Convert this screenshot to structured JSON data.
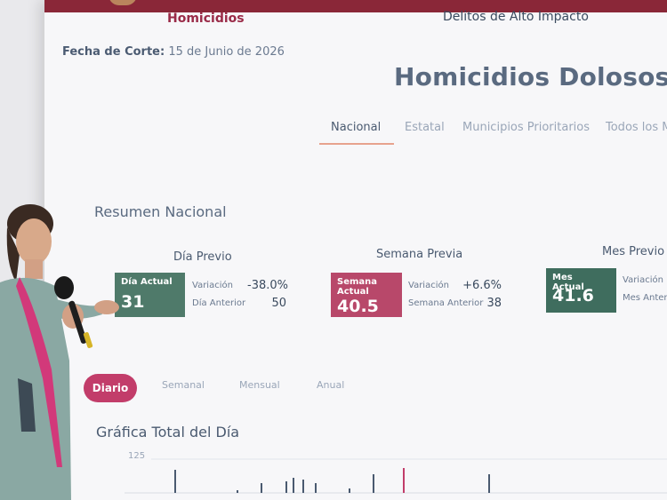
{
  "header": {
    "nav_homicidios": "Homicidios",
    "nav_delitos": "Delitos de Alto Impacto",
    "fecha_label": "Fecha de Corte:",
    "fecha_value": "15 de Junio de 2026",
    "page_title": "Homicidios Dolosos"
  },
  "tabs": [
    {
      "label": "Nacional",
      "active": true
    },
    {
      "label": "Estatal"
    },
    {
      "label": "Municipios Prioritarios"
    },
    {
      "label": "Todos los M"
    }
  ],
  "resumen": {
    "title": "Resumen Nacional",
    "groups": [
      {
        "title": "Día Previo",
        "card_label": "Día Actual",
        "card_value": "31",
        "var_label": "Variación",
        "var_value": "-38.0%",
        "prev_label": "Día Anterior",
        "prev_value": "50"
      },
      {
        "title": "Semana Previa",
        "card_label": "Semana Actual",
        "card_value": "40.5",
        "var_label": "Variación",
        "var_value": "+6.6%",
        "prev_label": "Semana Anterior",
        "prev_value": "38"
      },
      {
        "title": "Mes Previo",
        "card_label": "Mes Actual",
        "card_value": "41.6",
        "var_label": "Variación",
        "prev_label": "Mes Anterior"
      }
    ]
  },
  "period_tabs": [
    {
      "label": "Diario",
      "active": true
    },
    {
      "label": "Semanal"
    },
    {
      "label": "Mensual"
    },
    {
      "label": "Anual"
    }
  ],
  "chart": {
    "title": "Gráfica Total del Día",
    "ytick": "125"
  },
  "colors": {
    "band": "#8a2738",
    "card_green": "#4f7a6a",
    "card_pink": "#b8486a",
    "pill": "#c23d6a"
  }
}
